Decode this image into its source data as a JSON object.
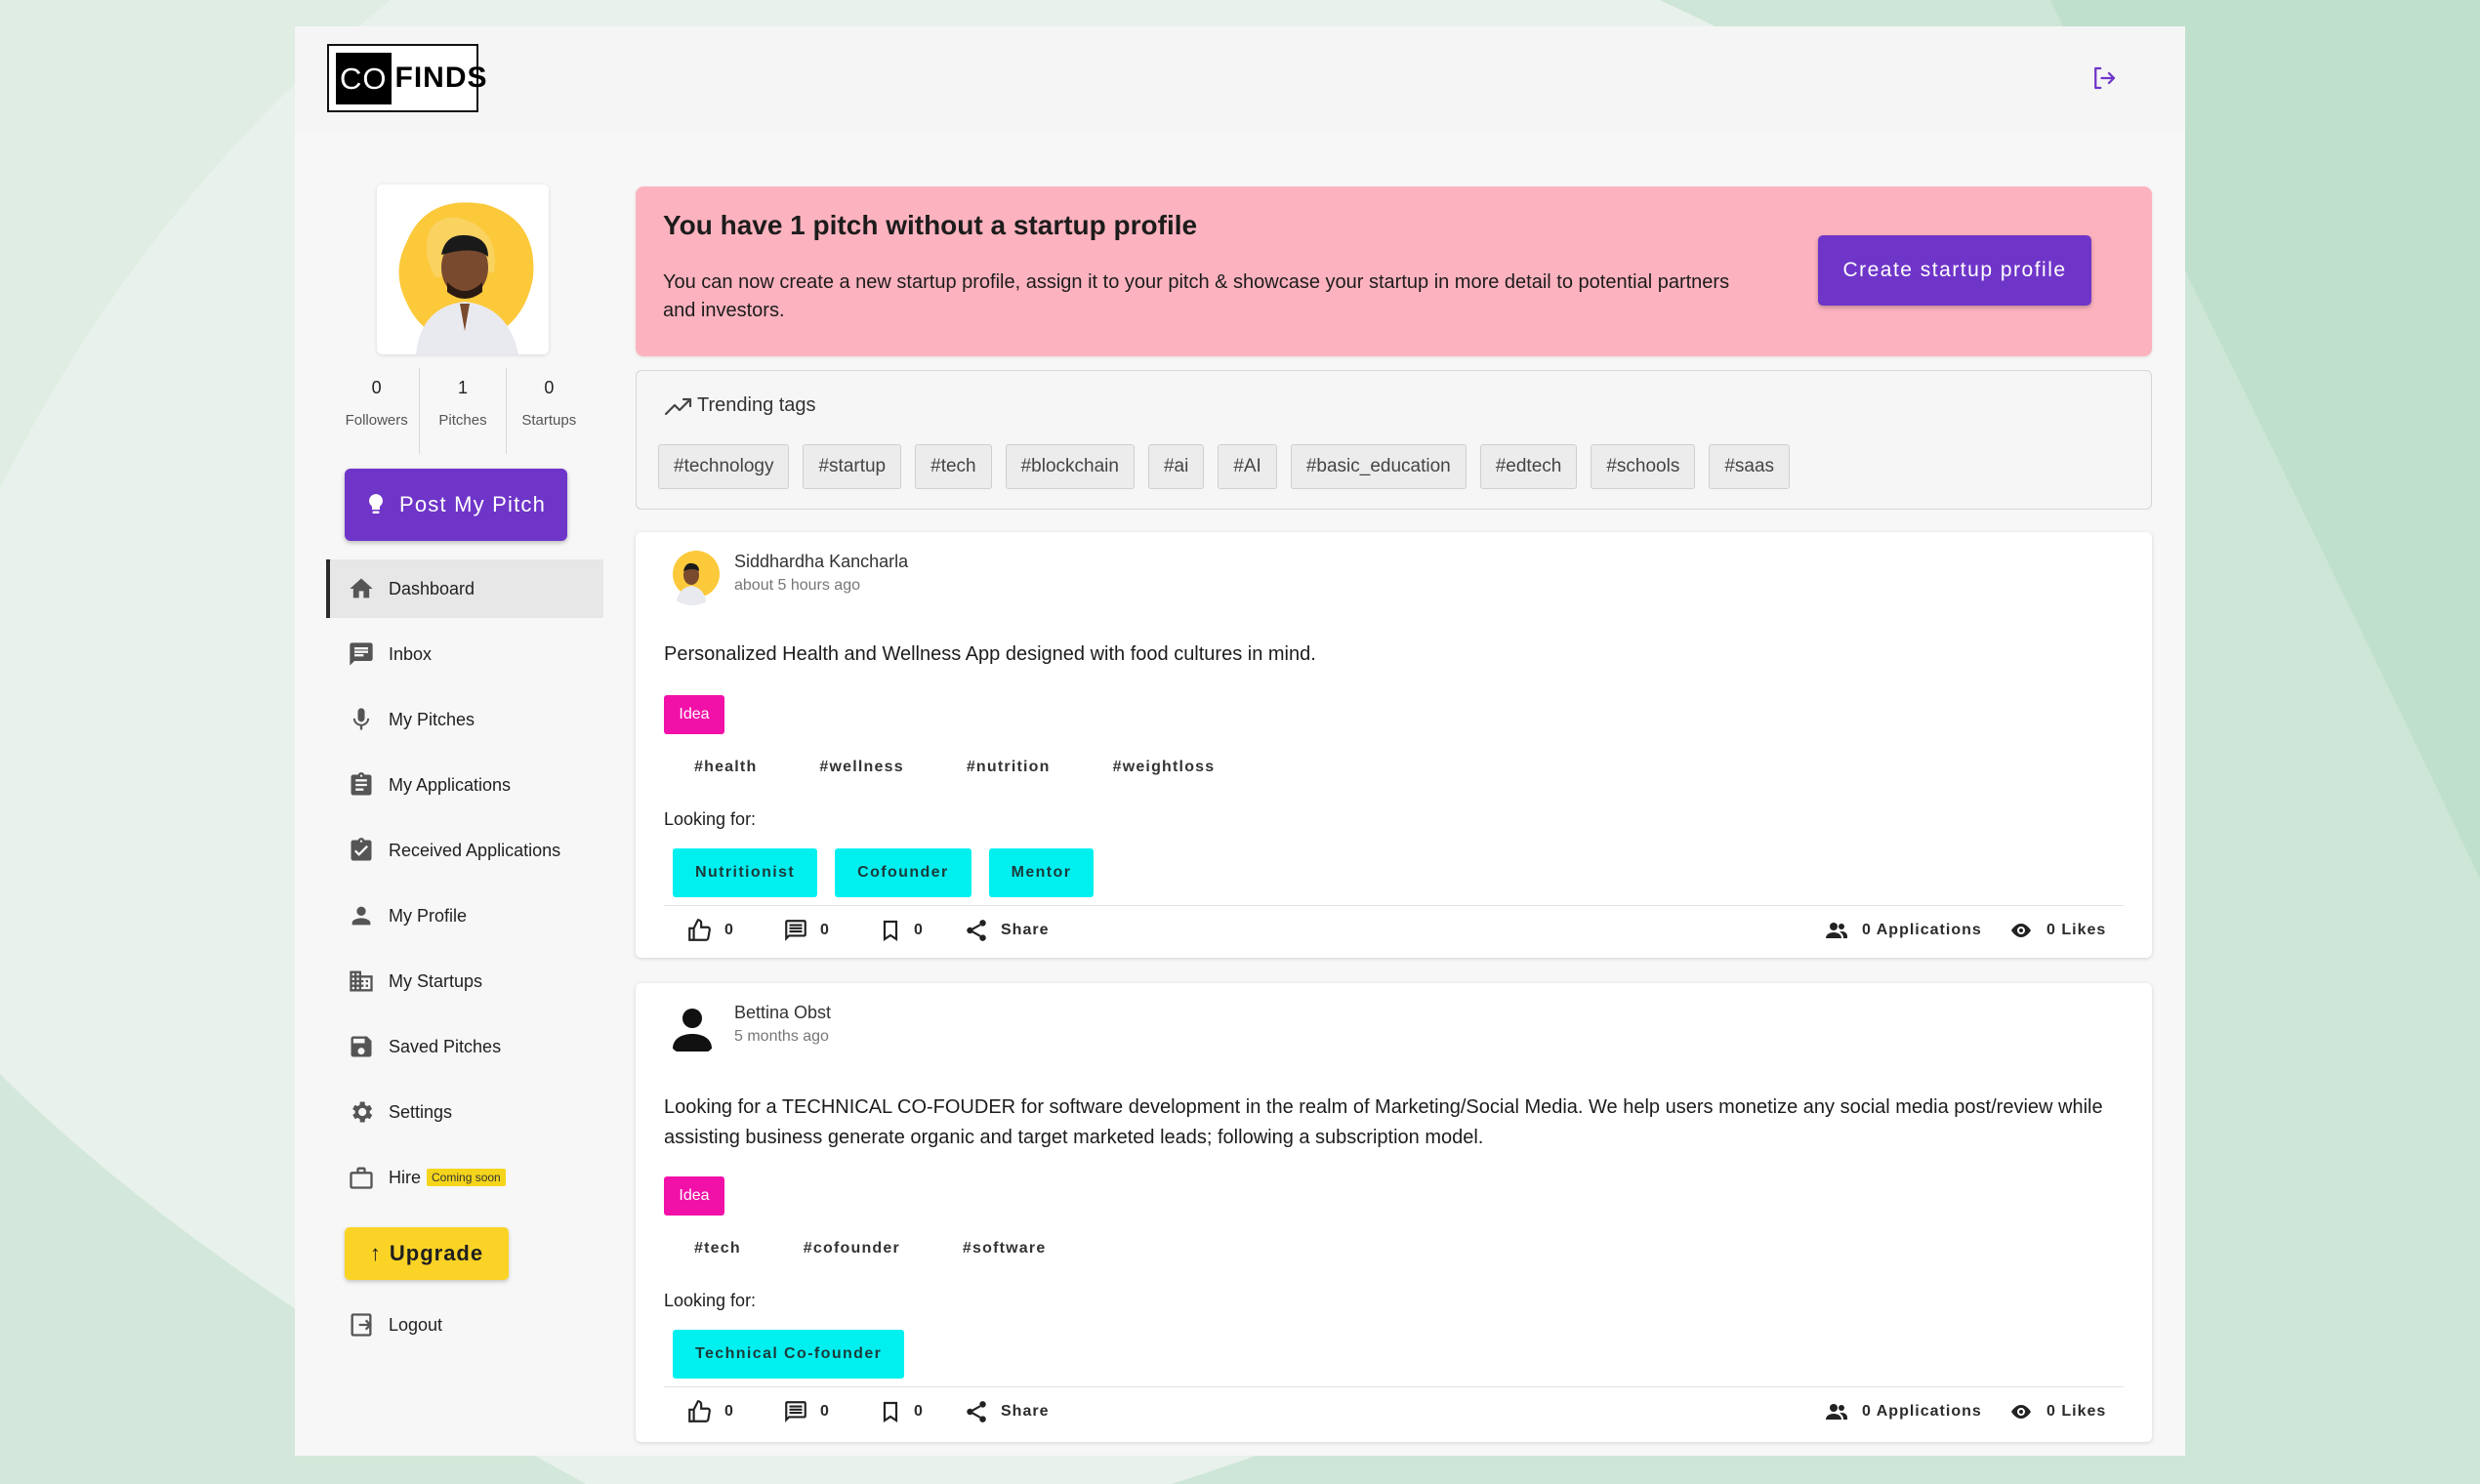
{
  "header": {
    "logo_co": "CO",
    "logo_finds": "FINDS"
  },
  "sidebar": {
    "stats": [
      {
        "value": "0",
        "label": "Followers"
      },
      {
        "value": "1",
        "label": "Pitches"
      },
      {
        "value": "0",
        "label": "Startups"
      }
    ],
    "post_button": "Post My Pitch",
    "nav": [
      {
        "label": "Dashboard",
        "icon": "home-icon"
      },
      {
        "label": "Inbox",
        "icon": "chat-icon"
      },
      {
        "label": "My Pitches",
        "icon": "microphone-icon"
      },
      {
        "label": "My Applications",
        "icon": "clipboard-icon"
      },
      {
        "label": "Received Applications",
        "icon": "clipboard-check-icon"
      },
      {
        "label": "My Profile",
        "icon": "person-icon"
      },
      {
        "label": "My Startups",
        "icon": "building-icon"
      },
      {
        "label": "Saved Pitches",
        "icon": "save-icon"
      },
      {
        "label": "Settings",
        "icon": "gear-icon"
      },
      {
        "label": "Hire",
        "icon": "briefcase-icon",
        "badge": "Coming soon"
      }
    ],
    "upgrade_button": "Upgrade",
    "logout": "Logout"
  },
  "banner": {
    "title": "You have 1 pitch without a startup profile",
    "description": "You can now create a new startup profile, assign it to your pitch & showcase your startup in more detail to potential partners and investors.",
    "cta": "Create startup profile",
    "background": "#fdb3bf"
  },
  "trending": {
    "title": "Trending tags",
    "tags": [
      "#technology",
      "#startup",
      "#tech",
      "#blockchain",
      "#ai",
      "#AI",
      "#basic_education",
      "#edtech",
      "#schools",
      "#saas"
    ]
  },
  "posts": [
    {
      "author": "Siddhardha Kancharla",
      "time": "about 5 hours ago",
      "title": "Personalized Health and Wellness App designed with food cultures in mind.",
      "stage": "Idea",
      "tags": [
        "#health",
        "#wellness",
        "#nutrition",
        "#weightloss"
      ],
      "looking_label": "Looking for:",
      "roles": [
        "Nutritionist",
        "Cofounder",
        "Mentor"
      ],
      "likes_count": "0",
      "comments_count": "0",
      "saves_count": "0",
      "share_label": "Share",
      "applications": "0 Applications",
      "views": "0 Likes"
    },
    {
      "author": "Bettina Obst",
      "time": "5 months ago",
      "title": "Looking for a TECHNICAL CO-FOUDER for software development in the realm of Marketing/Social Media. We help users monetize any social media post/review while assisting business generate organic and target marketed leads; following a subscription model.",
      "stage": "Idea",
      "tags": [
        "#tech",
        "#cofounder",
        "#software"
      ],
      "looking_label": "Looking for:",
      "roles": [
        "Technical Co-founder"
      ],
      "likes_count": "0",
      "comments_count": "0",
      "saves_count": "0",
      "share_label": "Share",
      "applications": "0 Applications",
      "views": "0 Likes"
    }
  ],
  "colors": {
    "accent": "#6f35c9",
    "idea_badge": "#f211a8",
    "role_chip": "#00f0f0",
    "upgrade": "#fad326"
  }
}
